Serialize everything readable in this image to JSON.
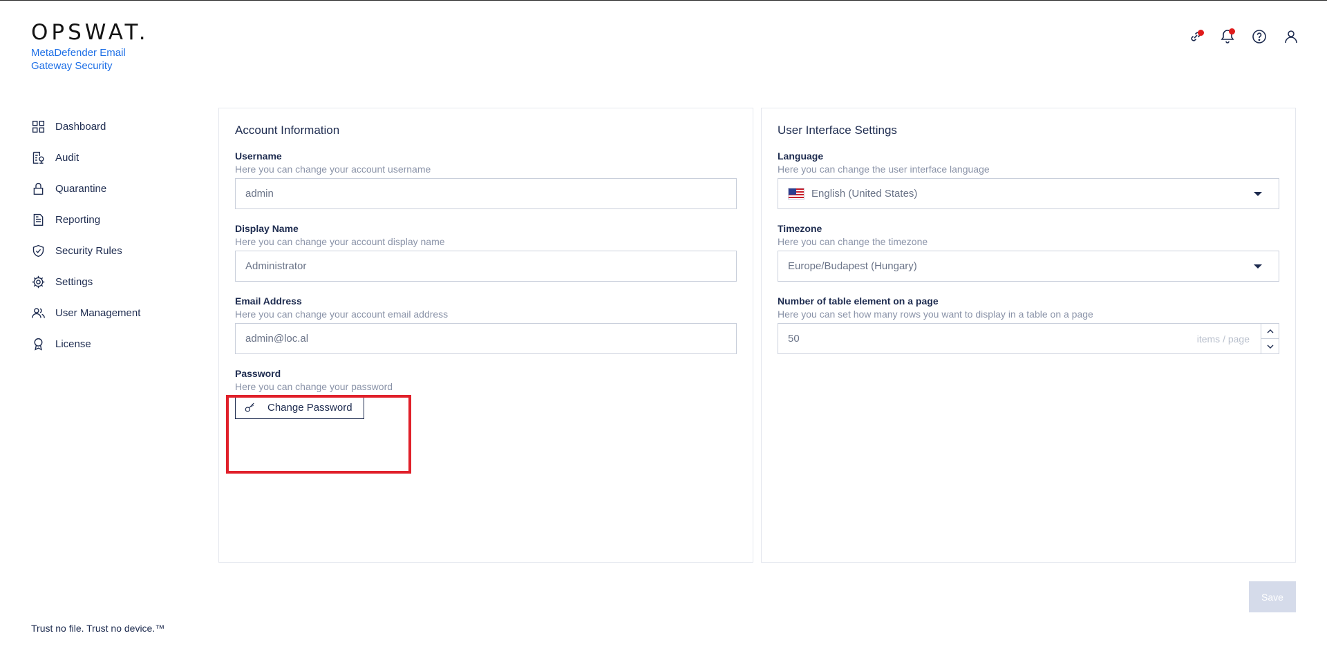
{
  "brand": {
    "logo": "OPSWAT.",
    "product": "MetaDefender Email Gateway Security"
  },
  "top_icons": [
    "network-icon",
    "notifications-icon",
    "help-icon",
    "user-icon"
  ],
  "sidebar": {
    "items": [
      {
        "label": "Dashboard",
        "icon": "dashboard-icon"
      },
      {
        "label": "Audit",
        "icon": "audit-icon"
      },
      {
        "label": "Quarantine",
        "icon": "lock-icon"
      },
      {
        "label": "Reporting",
        "icon": "document-icon"
      },
      {
        "label": "Security Rules",
        "icon": "shield-check-icon"
      },
      {
        "label": "Settings",
        "icon": "gear-icon"
      },
      {
        "label": "User Management",
        "icon": "users-icon"
      },
      {
        "label": "License",
        "icon": "badge-icon"
      }
    ]
  },
  "footer": {
    "tagline": "Trust no file. Trust no device.™"
  },
  "account": {
    "title": "Account Information",
    "username": {
      "label": "Username",
      "help": "Here you can change your account username",
      "value": "admin"
    },
    "display_name": {
      "label": "Display Name",
      "help": "Here you can change your account display name",
      "value": "Administrator"
    },
    "email": {
      "label": "Email Address",
      "help": "Here you can change your account email address",
      "value": "admin@loc.al"
    },
    "password": {
      "label": "Password",
      "help": "Here you can change your password",
      "button": "Change Password"
    }
  },
  "ui_settings": {
    "title": "User Interface Settings",
    "language": {
      "label": "Language",
      "help": "Here you can change the user interface language",
      "value": "English (United States)"
    },
    "timezone": {
      "label": "Timezone",
      "help": "Here you can change the timezone",
      "value": "Europe/Budapest (Hungary)"
    },
    "page_size": {
      "label": "Number of table element on a page",
      "help": "Here you can set how many rows you want to display in a table on a page",
      "value": "50",
      "suffix": "items / page"
    }
  },
  "actions": {
    "save": "Save"
  },
  "colors": {
    "accent": "#1d6fe6",
    "highlight": "#e0202a",
    "text": "#1d2b4f",
    "notification": "#e01b1b"
  }
}
